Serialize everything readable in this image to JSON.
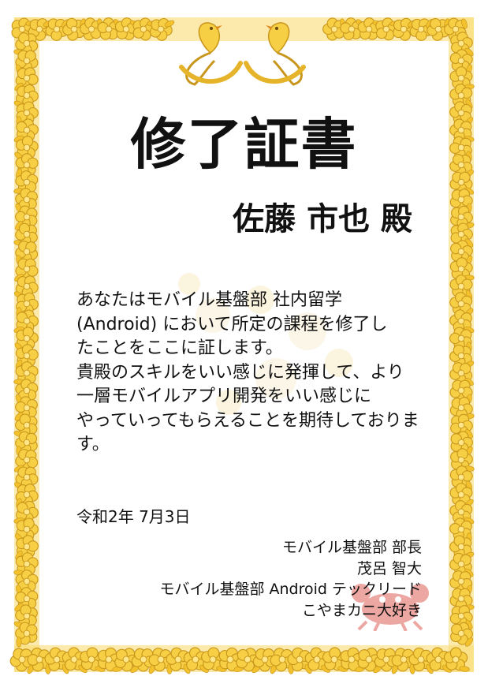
{
  "certificate": {
    "title": "修了証書",
    "recipient": "佐藤 市也 殿",
    "body_lines": [
      "あなたはモバイル基盤部 社内留学",
      "(Android) において所定の課程を修了し",
      "たことをここに証します。",
      "貴殿のスキルをいい感じに発揮して、より",
      "一層モバイルアプリ開発をいい感じに",
      "やっていってもらえることを期待しておりま",
      "す。"
    ],
    "date": "令和2年 7月3日",
    "signatures": [
      "モバイル基盤部 部長",
      "茂呂 智大",
      "モバイル基盤部 Android テックリード",
      "こやまカニ大好き"
    ]
  },
  "colors": {
    "border_gold": "#f4c531",
    "border_dark": "#c8961c",
    "flower_light": "#ffe68a",
    "text": "#111111",
    "crab_red": "#d9453c"
  },
  "icons": {
    "border": "golden-flower-border",
    "birds": "phoenix-bird-icon",
    "watermark": "faded-flower-watermark",
    "mascot": "crab-icon"
  }
}
